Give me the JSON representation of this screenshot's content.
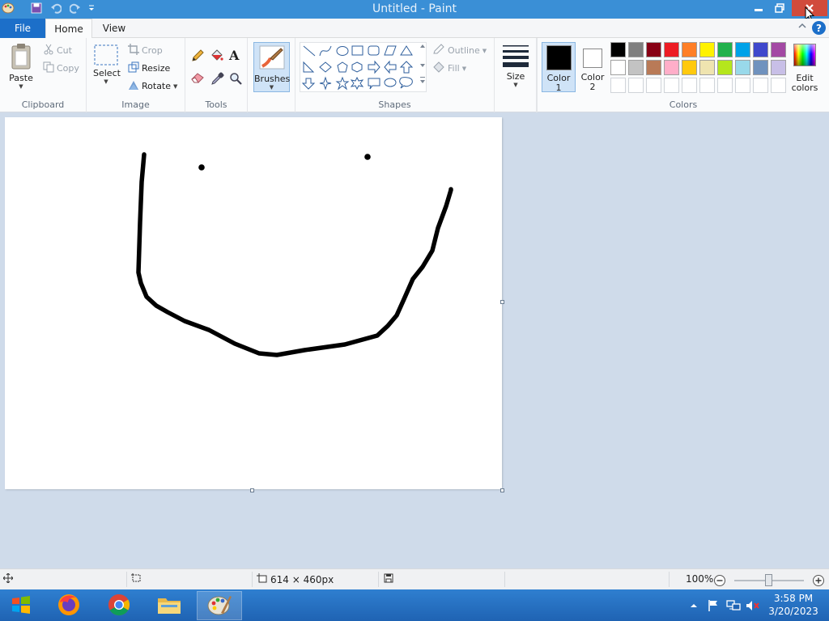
{
  "window": {
    "title": "Untitled - Paint"
  },
  "menu": {
    "file": "File",
    "home": "Home",
    "view": "View",
    "help": "?"
  },
  "ribbon": {
    "clipboard": {
      "label": "Clipboard",
      "paste": "Paste",
      "cut": "Cut",
      "copy": "Copy"
    },
    "image": {
      "label": "Image",
      "select": "Select",
      "crop": "Crop",
      "resize": "Resize",
      "rotate": "Rotate"
    },
    "tools": {
      "label": "Tools"
    },
    "brushes": {
      "label": "Brushes"
    },
    "shapes": {
      "label": "Shapes",
      "outline": "Outline",
      "fill": "Fill"
    },
    "size": {
      "label": "Size"
    },
    "colors": {
      "label": "Colors",
      "color1_line1": "Color",
      "color1_line2": "1",
      "color2_line1": "Color",
      "color2_line2": "2",
      "edit_line1": "Edit",
      "edit_line2": "colors",
      "color1_value": "#000000",
      "color2_value": "#ffffff",
      "palette_row1": [
        "#000000",
        "#7f7f7f",
        "#880015",
        "#ed1c24",
        "#ff7f27",
        "#fff200",
        "#22b14c",
        "#00a2e8",
        "#3f48cc",
        "#a349a4"
      ],
      "palette_row2": [
        "#ffffff",
        "#c3c3c3",
        "#b97a57",
        "#ffaec9",
        "#ffc90e",
        "#efe4b0",
        "#b5e61d",
        "#99d9ea",
        "#7092be",
        "#c8bfe7"
      ]
    }
  },
  "status": {
    "dimensions": "614 × 460px",
    "zoom": "100%"
  },
  "taskbar": {
    "time": "3:58 PM",
    "date": "3/20/2023"
  }
}
